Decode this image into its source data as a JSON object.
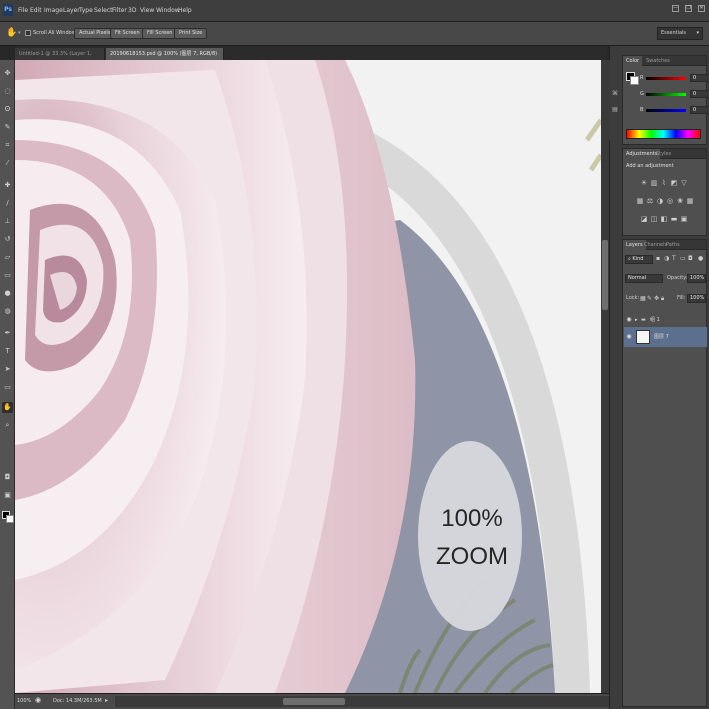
{
  "app": {
    "logo": "Ps"
  },
  "menu": [
    "File",
    "Edit",
    "Image",
    "Layer",
    "Type",
    "Select",
    "Filter",
    "3D",
    "View",
    "Window",
    "Help"
  ],
  "window_controls": {
    "minimize": "—",
    "restore": "❐",
    "close": "✕"
  },
  "options_bar": {
    "scroll_all_label": "Scroll All Windows",
    "actual_pixels": "Actual Pixels",
    "fit_screen": "Fit Screen",
    "fill_screen": "Fill Screen",
    "print_size": "Print Size",
    "workspace": "Essentials"
  },
  "tabs": [
    {
      "label": "Untitled-1 @ 33.3% (Layer 1, RGB/8) *",
      "active": false
    },
    {
      "label": "20190618153.psd @ 100% (图层 7, RGB/8)",
      "active": true
    }
  ],
  "canvas": {
    "zoom_badge_line1": "100%",
    "zoom_badge_line2": "ZOOM"
  },
  "status": {
    "zoom": "100%",
    "doc": "Doc: 14.3M/263.5M"
  },
  "color_panel": {
    "tabs": [
      "Color",
      "Swatches"
    ],
    "channels": [
      {
        "label": "R",
        "value": "0"
      },
      {
        "label": "G",
        "value": "0"
      },
      {
        "label": "B",
        "value": "0"
      }
    ]
  },
  "adjustments_panel": {
    "tabs": [
      "Adjustments",
      "Styles"
    ],
    "heading": "Add an adjustment"
  },
  "layers_panel": {
    "tabs": [
      "Layers",
      "Channels",
      "Paths"
    ],
    "filter": "Kind",
    "blend_mode": "Normal",
    "opacity_label": "Opacity:",
    "opacity": "100%",
    "lock_label": "Lock:",
    "fill_label": "Fill:",
    "fill": "100%",
    "layers": [
      {
        "name": "组 1",
        "type": "group",
        "selected": false
      },
      {
        "name": "图层 7",
        "type": "layer",
        "selected": true
      }
    ]
  },
  "tool_icons": [
    "move-icon",
    "marquee-icon",
    "lasso-icon",
    "quick-select-icon",
    "crop-icon",
    "eyedropper-icon",
    "healing-icon",
    "brush-icon",
    "stamp-icon",
    "history-brush-icon",
    "eraser-icon",
    "gradient-icon",
    "blur-icon",
    "dodge-icon",
    "pen-icon",
    "type-icon",
    "path-select-icon",
    "shape-icon",
    "hand-icon",
    "zoom-icon"
  ],
  "colors": {
    "accent_selected_layer": "#5c6f8c",
    "canvas_slate": "#8f95a6",
    "rose_pink": "#e7cfd6"
  }
}
